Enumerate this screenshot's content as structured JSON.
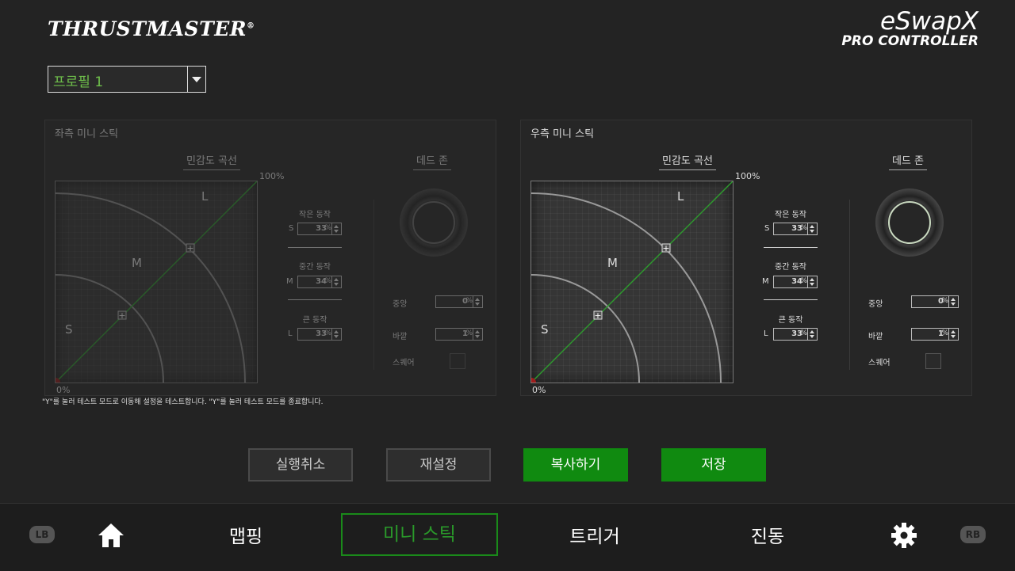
{
  "header": {
    "brand": "THRUSTMASTER",
    "brand_mark": "®",
    "product_line1": "eSwapX",
    "product_line2": "PRO CONTROLLER"
  },
  "profile_select": {
    "value": "프로필 1"
  },
  "left_panel": {
    "title": "좌측 미니 스틱",
    "curve_title": "민감도 곡선",
    "deadzone_title": "데드 존",
    "pct_max": "100%",
    "pct_min": "0%",
    "zone_s": "S",
    "zone_m": "M",
    "zone_l": "L",
    "small_label": "작은 동작",
    "small_letter": "S",
    "small_value": "33",
    "mid_label": "중간 동작",
    "mid_letter": "M",
    "mid_value": "34",
    "large_label": "큰 동작",
    "large_letter": "L",
    "large_value": "33",
    "center_label": "중앙",
    "center_value": "0",
    "outer_label": "바깥",
    "outer_value": "1",
    "square_label": "스퀘어",
    "unit": "%"
  },
  "right_panel": {
    "title": "우측 미니 스틱",
    "curve_title": "민감도 곡선",
    "deadzone_title": "데드 존",
    "pct_max": "100%",
    "pct_min": "0%",
    "zone_s": "S",
    "zone_m": "M",
    "zone_l": "L",
    "small_label": "작은 동작",
    "small_letter": "S",
    "small_value": "33",
    "mid_label": "중간 동작",
    "mid_letter": "M",
    "mid_value": "34",
    "large_label": "큰 동작",
    "large_letter": "L",
    "large_value": "33",
    "center_label": "중앙",
    "center_value": "0",
    "outer_label": "바깥",
    "outer_value": "1",
    "square_label": "스퀘어",
    "unit": "%"
  },
  "hint": "\"Y\"를 눌러 테스트 모드로 이동해 설정을 테스트합니다. \"Y\"를 눌러 테스트 모드를 종료합니다.",
  "actions": {
    "undo": "실행취소",
    "reset": "재설정",
    "copy": "복사하기",
    "save": "저장"
  },
  "nav": {
    "lb": "LB",
    "rb": "RB",
    "home_icon": "home-icon",
    "settings_icon": "gear-icon",
    "mapping": "맵핑",
    "mini_stick": "미니 스틱",
    "trigger": "트리거",
    "vibration": "진동"
  },
  "colors": {
    "accent_green": "#108a10",
    "curve_line": "#2e9a2e",
    "profile_text": "#6fc04b"
  }
}
